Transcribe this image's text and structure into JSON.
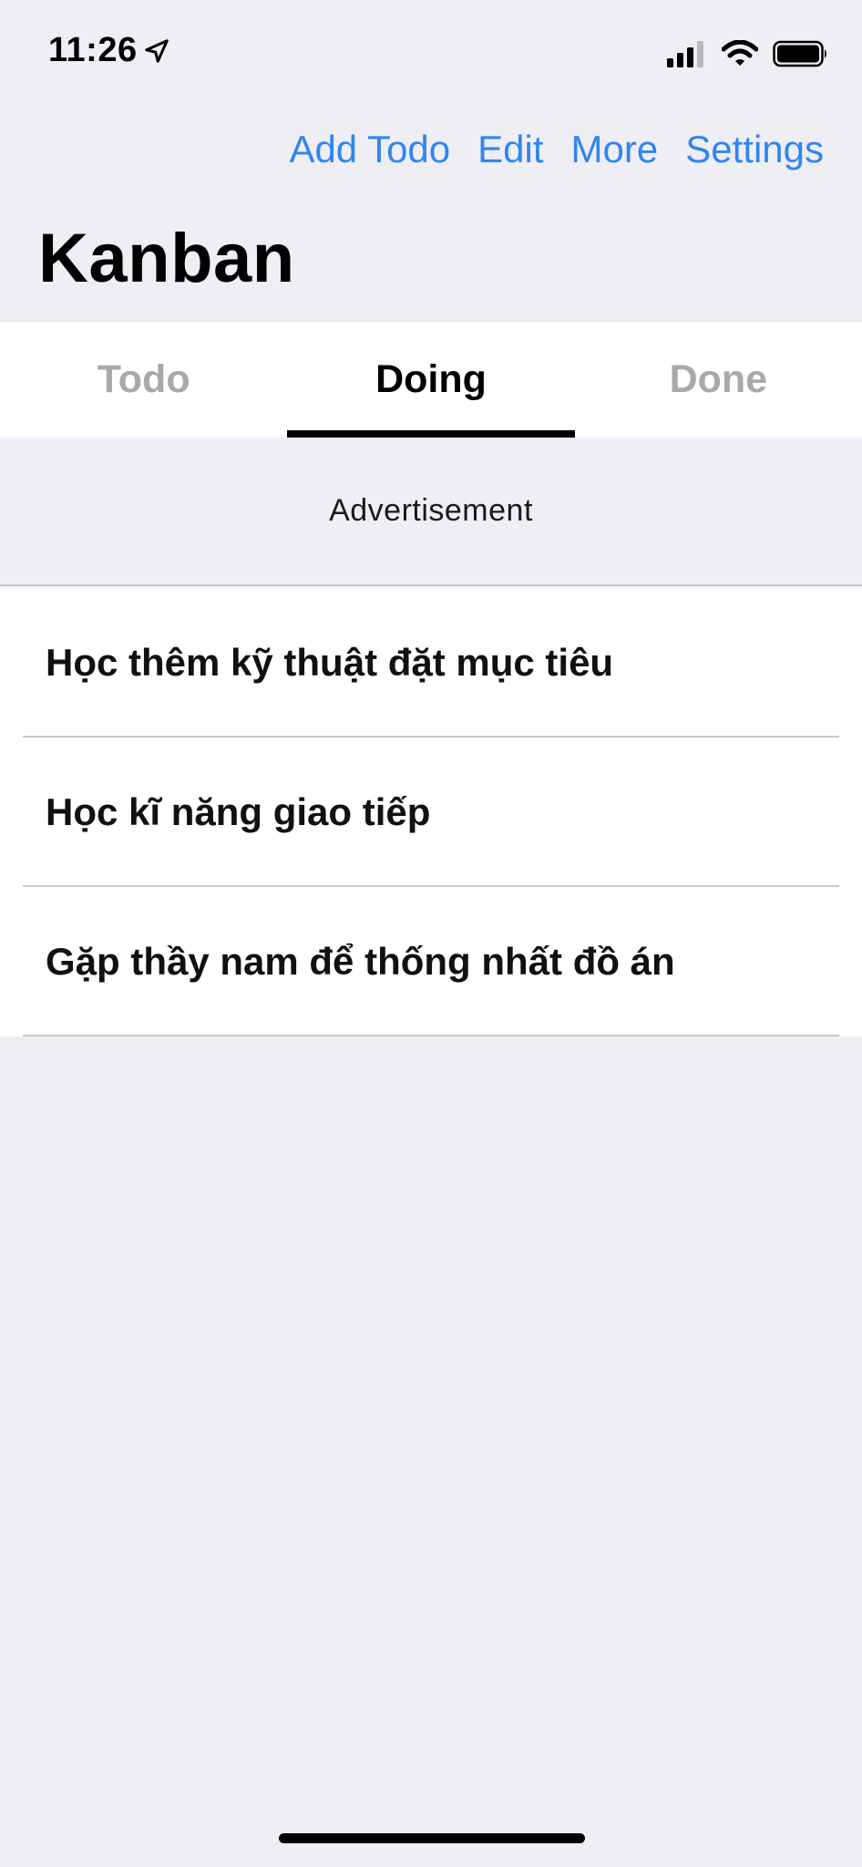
{
  "status_bar": {
    "time": "11:26",
    "location_icon": "location-arrow-icon",
    "signal_icon": "cellular-signal-icon",
    "wifi_icon": "wifi-icon",
    "battery_icon": "battery-icon"
  },
  "nav": {
    "actions": [
      "Add Todo",
      "Edit",
      "More",
      "Settings"
    ],
    "accent_color": "#2f86f1"
  },
  "header": {
    "title": "Kanban"
  },
  "tabs": [
    {
      "label": "Todo",
      "active": false
    },
    {
      "label": "Doing",
      "active": true
    },
    {
      "label": "Done",
      "active": false
    }
  ],
  "ad": {
    "label": "Advertisement"
  },
  "tasks": [
    "Học thêm kỹ thuật đặt mục tiêu",
    "Học kĩ năng giao tiếp",
    "Gặp thầy nam để thống nhất đồ án"
  ]
}
